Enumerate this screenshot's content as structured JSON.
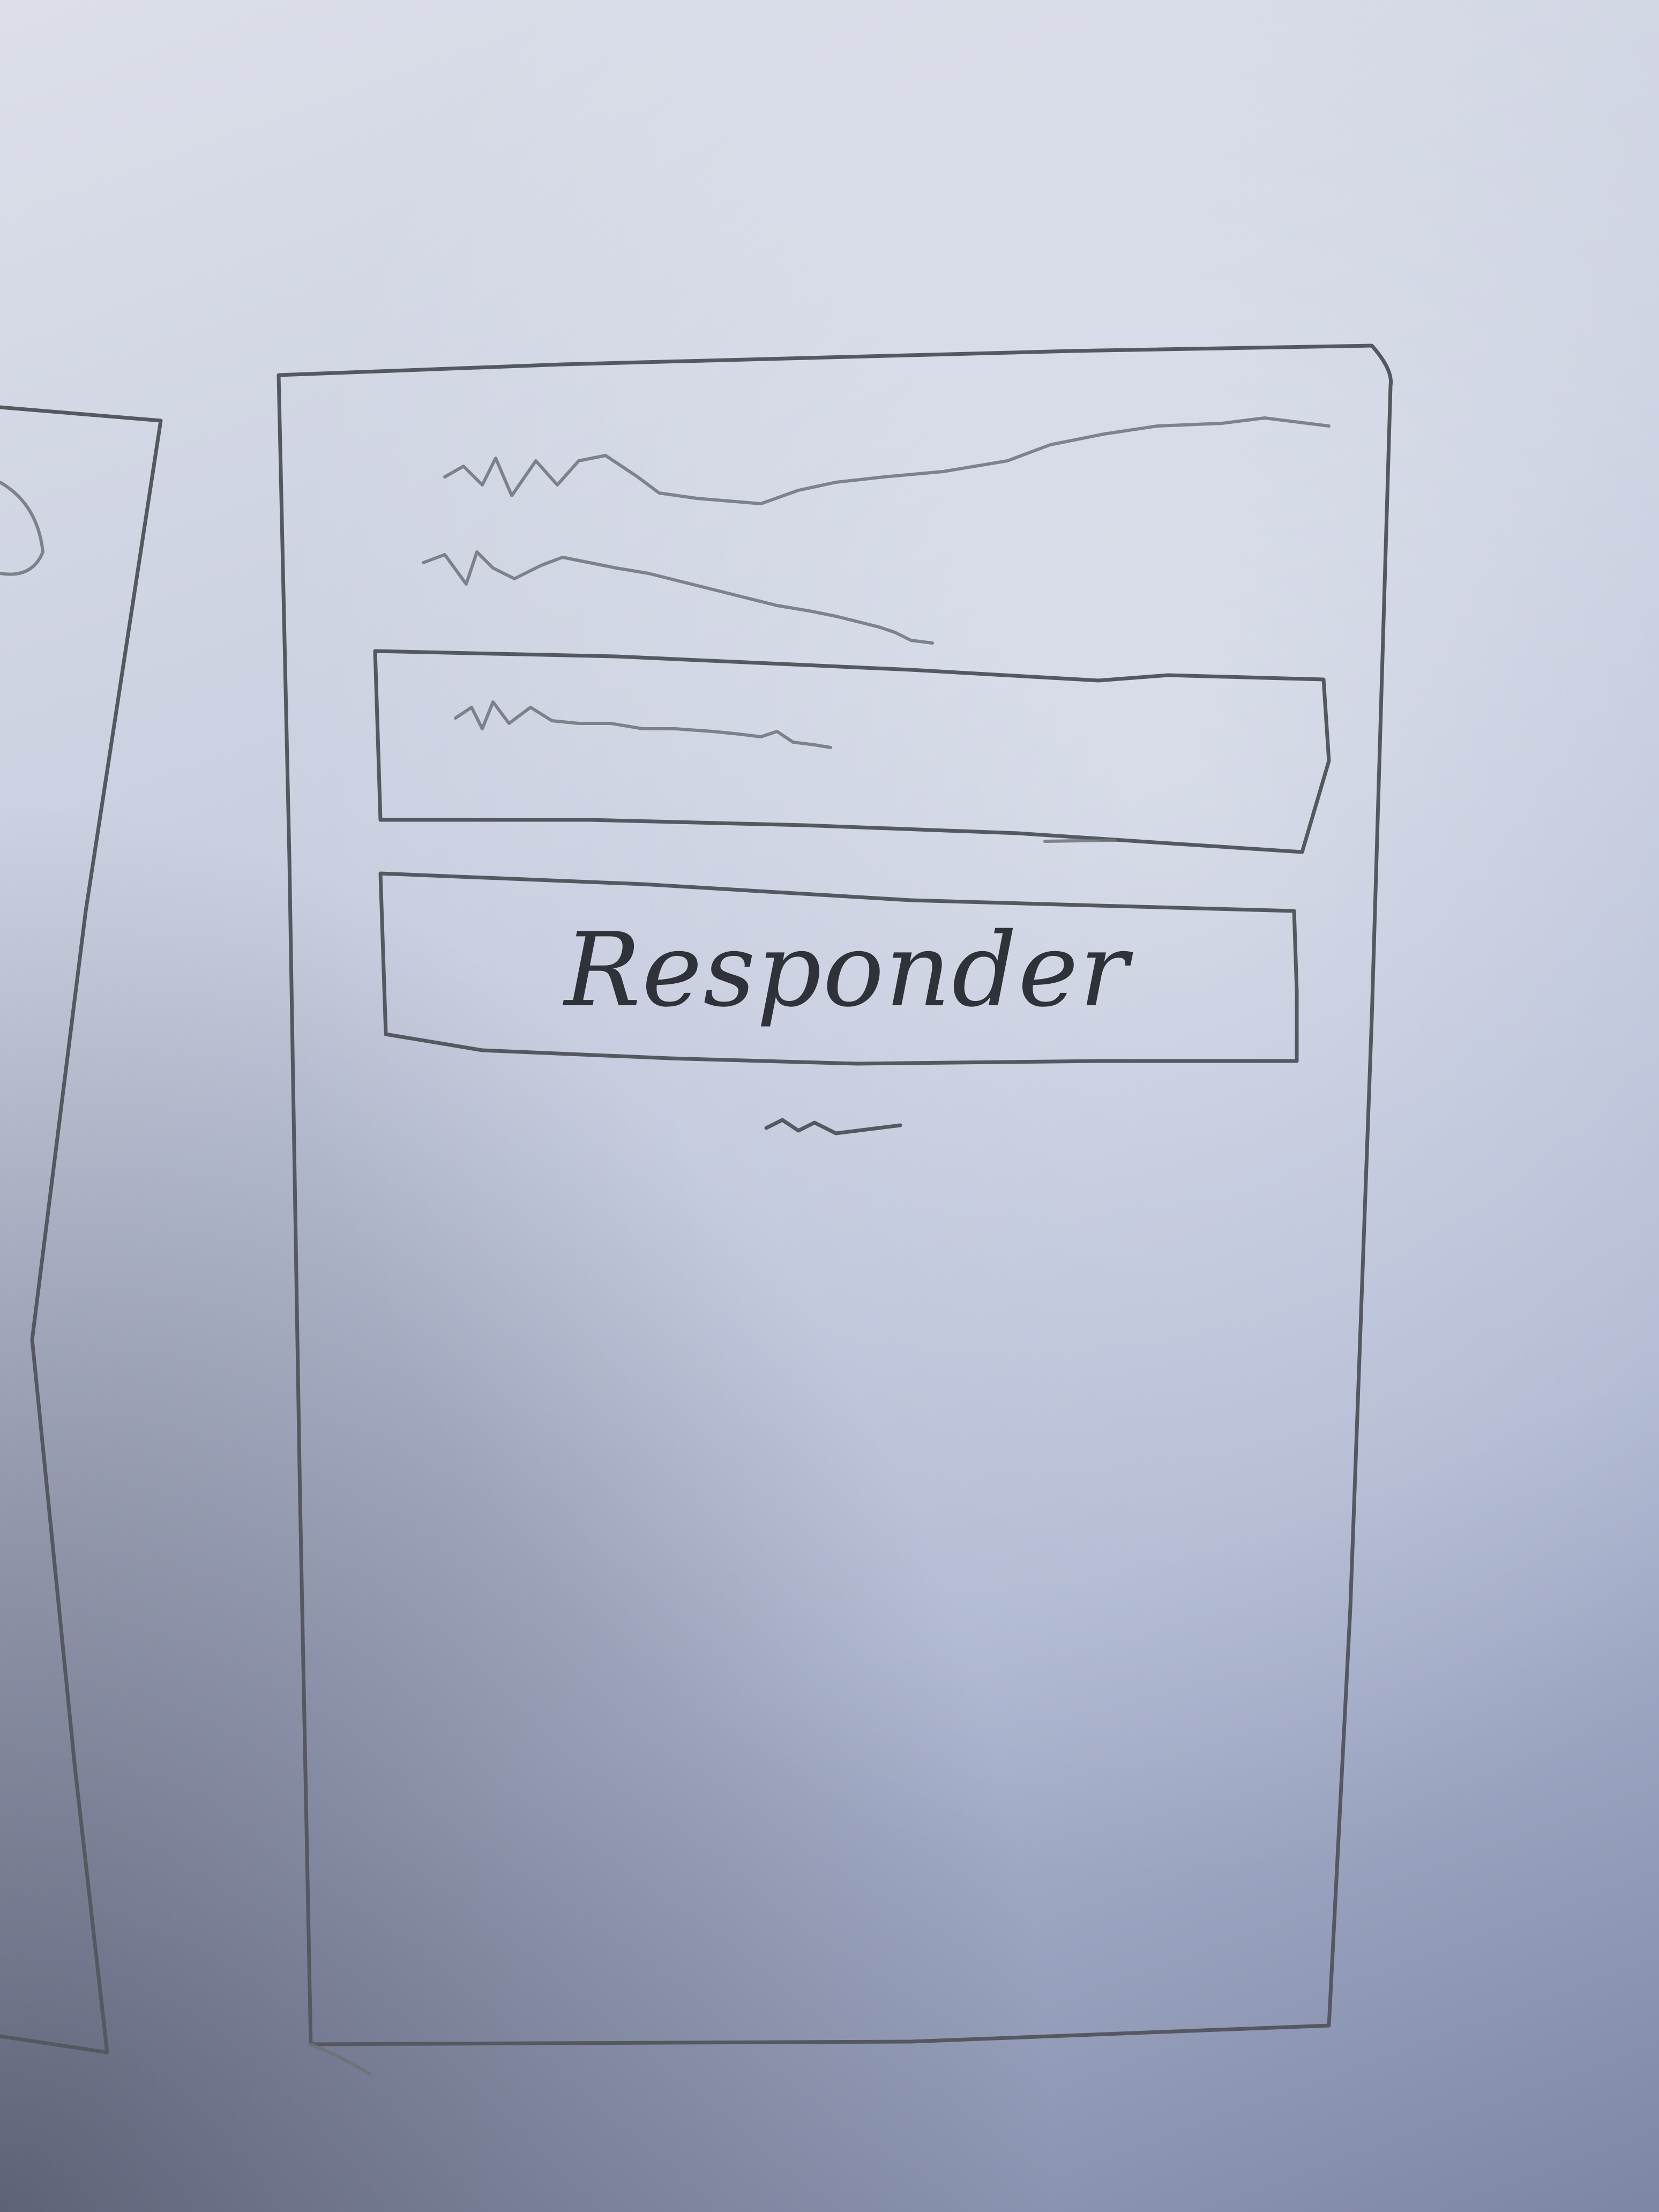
{
  "screen": {
    "primary_button": {
      "label": "Responder"
    },
    "left_screen_partial": {}
  }
}
